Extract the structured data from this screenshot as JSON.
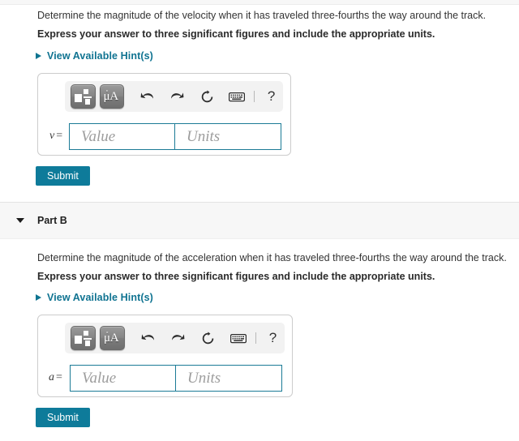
{
  "parts": [
    {
      "id": "part-a",
      "header_visible": false,
      "title": "",
      "question": "Determine the magnitude of the velocity when it has traveled three-fourths the way around the track.",
      "instruction": "Express your answer to three significant figures and include the appropriate units.",
      "hints_label": "View Available Hint(s)",
      "variable": "v",
      "equals": "=",
      "value_placeholder": "Value",
      "units_placeholder": "Units",
      "value_text": "",
      "units_text": "",
      "submit_label": "Submit",
      "toolbar": {
        "template_button": "template-tool",
        "units_button": "μÅ",
        "mu_text": "μ",
        "angstrom_text": "A",
        "ring_text": "˚",
        "undo": "undo",
        "redo": "redo",
        "reset": "reset",
        "keyboard": "keyboard",
        "help": "?"
      }
    },
    {
      "id": "part-b",
      "header_visible": true,
      "title": "Part B",
      "question": "Determine the magnitude of the acceleration when it has traveled three-fourths the way around the track.",
      "instruction": "Express your answer to three significant figures and include the appropriate units.",
      "hints_label": "View Available Hint(s)",
      "variable": "a",
      "equals": "=",
      "value_placeholder": "Value",
      "units_placeholder": "Units",
      "value_text": "",
      "units_text": "",
      "submit_label": "Submit",
      "toolbar": {
        "template_button": "template-tool",
        "units_button": "μÅ",
        "mu_text": "μ",
        "angstrom_text": "A",
        "ring_text": "˚",
        "undo": "undo",
        "redo": "redo",
        "reset": "reset",
        "keyboard": "keyboard",
        "help": "?"
      }
    }
  ],
  "colors": {
    "link": "#0f7391",
    "submit_bg": "#0e7b9a",
    "input_border": "#1b7b96",
    "panel_bg": "#f7f7f7",
    "box_border": "#cccccc",
    "toolbar_bg": "#f2f2f2"
  }
}
